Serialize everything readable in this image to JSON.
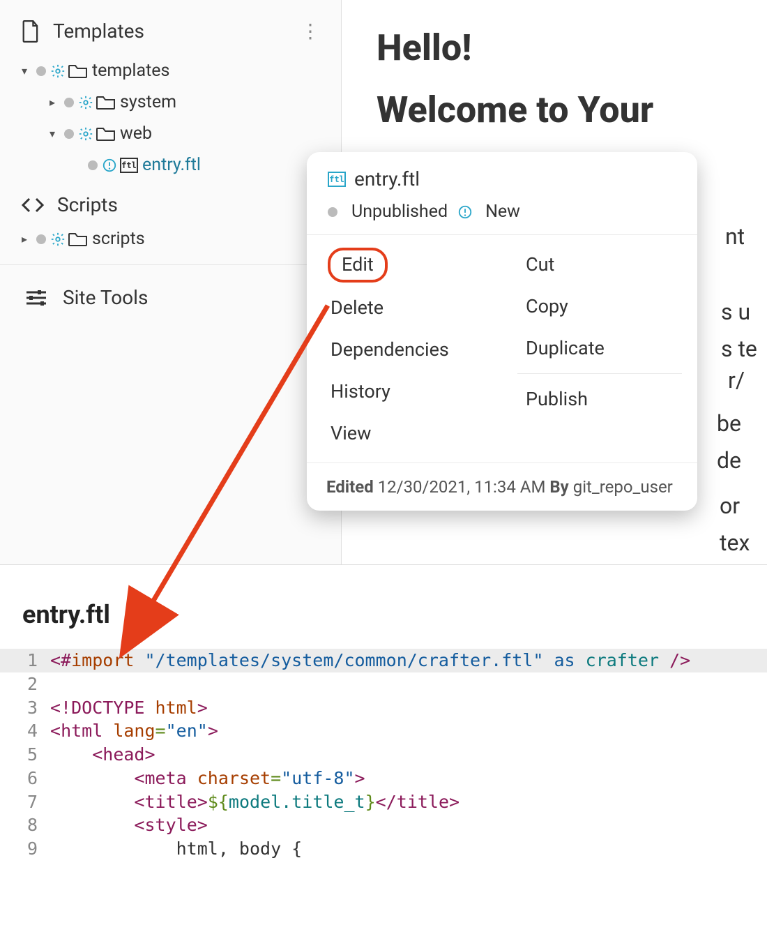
{
  "sidebar": {
    "sections": {
      "templates": {
        "label": "Templates",
        "items": [
          {
            "label": "templates",
            "expanded": true
          },
          {
            "label": "system",
            "expanded": false
          },
          {
            "label": "web",
            "expanded": true
          },
          {
            "label": "entry.ftl",
            "active": true
          }
        ]
      },
      "scripts": {
        "label": "Scripts",
        "items": [
          {
            "label": "scripts",
            "expanded": false
          }
        ]
      },
      "site_tools": {
        "label": "Site Tools"
      }
    }
  },
  "content": {
    "heading1": "Hello!",
    "heading2": "Welcome to Your",
    "body_fragments": [
      "nt",
      "s u\ns te",
      "r/",
      " be\n de",
      "or\ntex"
    ]
  },
  "context_menu": {
    "file": "entry.ftl",
    "status_unpublished": "Unpublished",
    "status_new": "New",
    "left_items": [
      "Edit",
      "Delete",
      "Dependencies",
      "History",
      "View"
    ],
    "right_items": [
      "Cut",
      "Copy",
      "Duplicate",
      "Publish"
    ],
    "footer_prefix": "Edited",
    "footer_timestamp": "12/30/2021, 11:34 AM",
    "footer_by": "By",
    "footer_user": "git_repo_user"
  },
  "editor": {
    "filename": "entry.ftl",
    "lines": [
      {
        "n": 1,
        "tokens": [
          {
            "t": "<#",
            "c": "c-tag"
          },
          {
            "t": "import ",
            "c": "c-attr"
          },
          {
            "t": "\"/templates/system/common/crafter.ftl\"",
            "c": "c-str"
          },
          {
            "t": " as ",
            "c": "c-kw"
          },
          {
            "t": "crafter ",
            "c": "c-ident"
          },
          {
            "t": "/>",
            "c": "c-tag"
          }
        ]
      },
      {
        "n": 2,
        "tokens": []
      },
      {
        "n": 3,
        "tokens": [
          {
            "t": "<!DOCTYPE ",
            "c": "c-tag"
          },
          {
            "t": "html",
            "c": "c-attr"
          },
          {
            "t": ">",
            "c": "c-tag"
          }
        ]
      },
      {
        "n": 4,
        "tokens": [
          {
            "t": "<",
            "c": "c-tag"
          },
          {
            "t": "html ",
            "c": "c-tag"
          },
          {
            "t": "lang",
            "c": "c-attr"
          },
          {
            "t": "=",
            "c": "c-op"
          },
          {
            "t": "\"en\"",
            "c": "c-str"
          },
          {
            "t": ">",
            "c": "c-tag"
          }
        ]
      },
      {
        "n": 5,
        "tokens": [
          {
            "t": "    ",
            "c": "c-plain"
          },
          {
            "t": "<",
            "c": "c-tag"
          },
          {
            "t": "head",
            "c": "c-tag"
          },
          {
            "t": ">",
            "c": "c-tag"
          }
        ]
      },
      {
        "n": 6,
        "tokens": [
          {
            "t": "        ",
            "c": "c-plain"
          },
          {
            "t": "<",
            "c": "c-tag"
          },
          {
            "t": "meta ",
            "c": "c-tag"
          },
          {
            "t": "charset",
            "c": "c-attr"
          },
          {
            "t": "=",
            "c": "c-op"
          },
          {
            "t": "\"utf-8\"",
            "c": "c-str"
          },
          {
            "t": ">",
            "c": "c-tag"
          }
        ]
      },
      {
        "n": 7,
        "tokens": [
          {
            "t": "        ",
            "c": "c-plain"
          },
          {
            "t": "<",
            "c": "c-tag"
          },
          {
            "t": "title",
            "c": "c-tag"
          },
          {
            "t": ">",
            "c": "c-tag"
          },
          {
            "t": "${",
            "c": "c-expr"
          },
          {
            "t": "model.title_t",
            "c": "c-ident"
          },
          {
            "t": "}",
            "c": "c-expr"
          },
          {
            "t": "</",
            "c": "c-tag"
          },
          {
            "t": "title",
            "c": "c-tag"
          },
          {
            "t": ">",
            "c": "c-tag"
          }
        ]
      },
      {
        "n": 8,
        "tokens": [
          {
            "t": "        ",
            "c": "c-plain"
          },
          {
            "t": "<",
            "c": "c-tag"
          },
          {
            "t": "style",
            "c": "c-tag"
          },
          {
            "t": ">",
            "c": "c-tag"
          }
        ]
      },
      {
        "n": 9,
        "tokens": [
          {
            "t": "            html, body {",
            "c": "c-plain"
          }
        ]
      }
    ]
  },
  "icons": {
    "ftl_label": "ftl"
  }
}
